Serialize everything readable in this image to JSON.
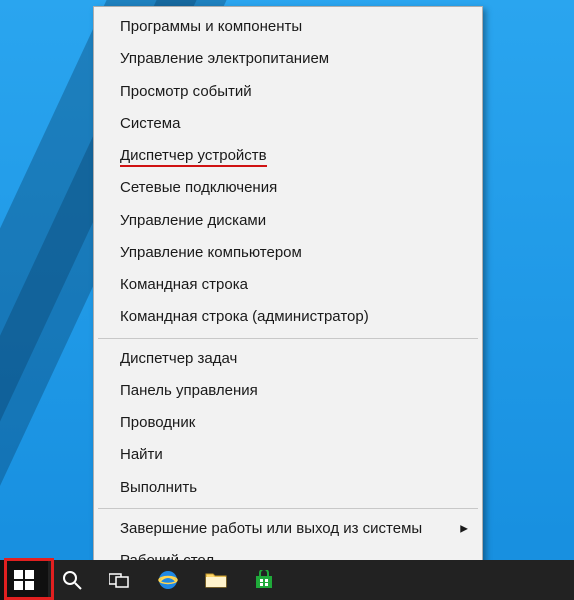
{
  "menu": {
    "group1": [
      {
        "label": "Программы и компоненты"
      },
      {
        "label": "Управление электропитанием"
      },
      {
        "label": "Просмотр событий"
      },
      {
        "label": "Система"
      },
      {
        "label": "Диспетчер устройств",
        "highlighted": true
      },
      {
        "label": "Сетевые подключения"
      },
      {
        "label": "Управление дисками"
      },
      {
        "label": "Управление компьютером"
      },
      {
        "label": "Командная строка"
      },
      {
        "label": "Командная строка (администратор)"
      }
    ],
    "group2": [
      {
        "label": "Диспетчер задач"
      },
      {
        "label": "Панель управления"
      },
      {
        "label": "Проводник"
      },
      {
        "label": "Найти"
      },
      {
        "label": "Выполнить"
      }
    ],
    "group3": [
      {
        "label": "Завершение работы или выход из системы",
        "submenu": true
      },
      {
        "label": "Рабочий стол"
      }
    ]
  },
  "taskbar": {
    "buttons": [
      {
        "name": "start-button",
        "icon": "windows-icon"
      },
      {
        "name": "search-button",
        "icon": "search-icon"
      },
      {
        "name": "task-view-button",
        "icon": "task-view-icon"
      },
      {
        "name": "ie-button",
        "icon": "ie-icon"
      },
      {
        "name": "explorer-button",
        "icon": "folder-icon"
      },
      {
        "name": "store-button",
        "icon": "store-icon"
      }
    ]
  },
  "colors": {
    "taskbar": "#222222",
    "desktop": "#1e98e4",
    "highlight_red": "#e22020",
    "underline_red": "#d01212"
  }
}
